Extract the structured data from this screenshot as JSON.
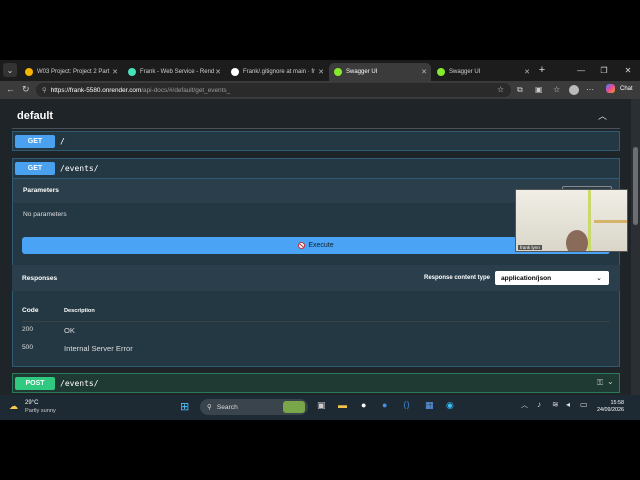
{
  "tabs": [
    {
      "title": "W03 Project: Project 2 Part",
      "color": "#f4b400"
    },
    {
      "title": "Frank - Web Service - Rend",
      "color": "#46e3b7"
    },
    {
      "title": "Frank/.gitignore at main · fr",
      "color": "#ffffff"
    },
    {
      "title": "Swagger UI",
      "color": "#85ea2d"
    },
    {
      "title": "Swagger UI",
      "color": "#85ea2d"
    }
  ],
  "address": {
    "host": "https://frank-5580.onrender.com",
    "path": "/api-docs/#/default/get_events_"
  },
  "chat_label": "Chat",
  "page": {
    "section_title": "default",
    "op1": {
      "method": "GET",
      "path": "/"
    },
    "op2": {
      "method": "GET",
      "path": "/events/"
    },
    "parameters_label": "Parameters",
    "no_parameters": "No parameters",
    "execute_label": "Execute",
    "responses_label": "Responses",
    "content_type_label": "Response content type",
    "content_type_value": "application/json",
    "col_code": "Code",
    "col_description": "Description",
    "responses": [
      {
        "code": "200",
        "description": "OK"
      },
      {
        "code": "500",
        "description": "Internal Server Error"
      }
    ],
    "op3": {
      "method": "POST",
      "path": "/events/"
    }
  },
  "video": {
    "name": "frank lynn"
  },
  "taskbar": {
    "weather_temp": "29°C",
    "weather_desc": "Partly sunny",
    "search_placeholder": "Search",
    "time": "15:58",
    "date": "24/09/2026"
  }
}
